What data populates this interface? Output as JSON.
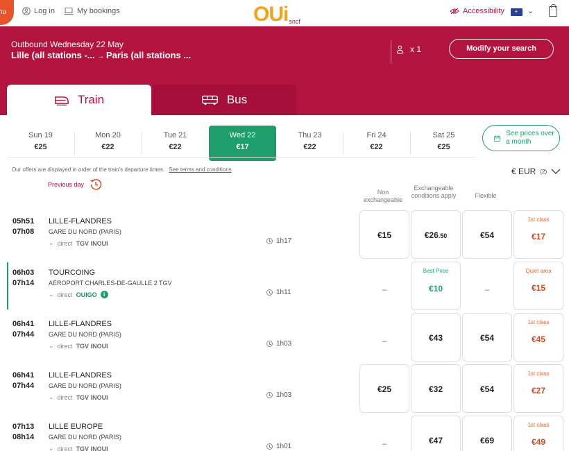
{
  "header": {
    "menu_label": "nu",
    "login": "Log in",
    "bookings": "My bookings",
    "logo_main": "OUi",
    "logo_sub": "sncf",
    "accessibility": "Accessibility"
  },
  "journey": {
    "outbound": "Outbound Wednesday 22 May",
    "from": "Lille (all stations -...",
    "to": "Paris (all stations ...",
    "passengers": "x 1",
    "modify": "Modify your search"
  },
  "tabs": [
    {
      "label": "Train"
    },
    {
      "label": "Bus"
    }
  ],
  "dates": [
    {
      "day": "Sun 19",
      "price": "€25"
    },
    {
      "day": "Mon 20",
      "price": "€22"
    },
    {
      "day": "Tue 21",
      "price": "€22"
    },
    {
      "day": "Wed 22",
      "price": "€17",
      "selected": true
    },
    {
      "day": "Thu 23",
      "price": "€22"
    },
    {
      "day": "Fri 24",
      "price": "€22"
    },
    {
      "day": "Sat 25",
      "price": "€25"
    }
  ],
  "see_prices": "See prices over a month",
  "offers_note": "Our offers are displayed in order of the train's departure times.",
  "terms_link": "See terms and conditions",
  "currency": "€ EUR",
  "currency_note": "(2)",
  "previous_day": "Previous day",
  "columns": {
    "non_exchangeable": "Non exchangeable",
    "exchangeable": "Exchangeable conditions apply",
    "flexible": "Flexible"
  },
  "rows": [
    {
      "dep": "05h51",
      "arr": "07h08",
      "from": "LILLE-FLANDRES",
      "to": "GARE DU NORD (PARIS)",
      "kind": "direct",
      "brand": "TGV INOUI",
      "duration": "1h17",
      "non_exch": "€15",
      "exch": "€26",
      "exch_cents": ".50",
      "flex": "€54",
      "extra_label": "1st class",
      "extra_value": "€17"
    },
    {
      "dep": "06h03",
      "arr": "07h14",
      "from": "TOURCOING",
      "to": "AÉROPORT CHARLES-DE-GAULLE 2 TGV",
      "kind": "direct",
      "brand": "OUIGO",
      "duration": "1h11",
      "non_exch": "–",
      "exch_label": "Best Price",
      "exch": "€10",
      "flex": "–",
      "extra_label": "Quiet area",
      "extra_value": "€15"
    },
    {
      "dep": "06h41",
      "arr": "07h44",
      "from": "LILLE-FLANDRES",
      "to": "GARE DU NORD (PARIS)",
      "kind": "direct",
      "brand": "TGV INOUI",
      "duration": "1h03",
      "non_exch": "–",
      "exch": "€43",
      "flex": "€54",
      "extra_label": "1st class",
      "extra_value": "€45"
    },
    {
      "dep": "06h41",
      "arr": "07h44",
      "from": "LILLE-FLANDRES",
      "to": "GARE DU NORD (PARIS)",
      "kind": "direct",
      "brand": "TGV INOUI",
      "duration": "1h03",
      "non_exch": "€25",
      "exch": "€32",
      "flex": "€54",
      "extra_label": "1st class",
      "extra_value": "€27"
    },
    {
      "dep": "07h13",
      "arr": "08h14",
      "from": "LILLE EUROPE",
      "to": "GARE DU NORD (PARIS)",
      "kind": "direct",
      "brand": "TGV INOUI",
      "duration": "1h01",
      "non_exch": "–",
      "exch": "€47",
      "flex": "€69",
      "extra_label": "1st class",
      "extra_value": "€49"
    }
  ],
  "colors": {
    "brand_red": "#b2133f",
    "green": "#1e9e6a",
    "orange": "#d44a1f"
  }
}
